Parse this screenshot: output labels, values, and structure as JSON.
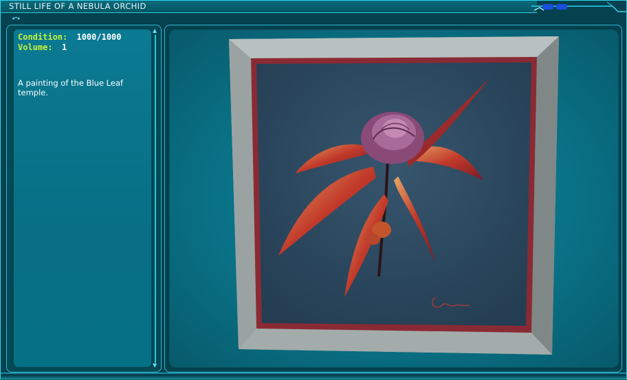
{
  "window": {
    "title": "STILL LIFE OF A NEBULA ORCHID"
  },
  "item": {
    "condition_label": "Condition:",
    "condition_value": "1000/1000",
    "volume_label": "Volume:",
    "volume_value": "1",
    "description": "A painting of the Blue Leaf temple."
  },
  "icons": {
    "drag": "drag-handle-icon",
    "close": "close-icon",
    "scroll_up": "scroll-up-icon",
    "scroll_down": "scroll-down-icon"
  },
  "colors": {
    "frame_border": "#2fd6ee",
    "panel_bg": "#086f86",
    "label_green": "#c8f23a",
    "canvas_bg": "#2c4a62",
    "flower_red": "#b2292c"
  }
}
